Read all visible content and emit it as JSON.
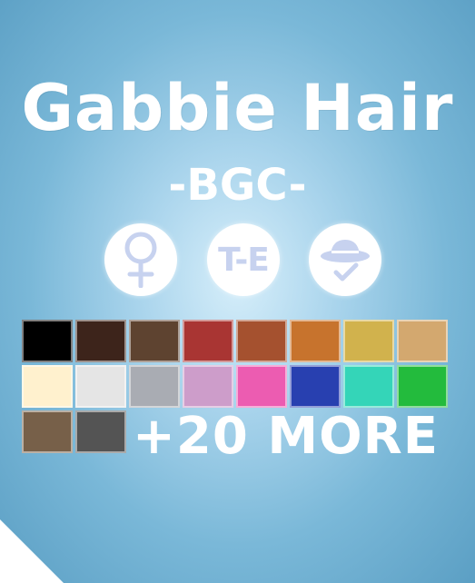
{
  "title": "Gabbie Hair",
  "subtitle": "-BGC-",
  "badges": [
    {
      "icon": "female-symbol-icon"
    },
    {
      "label": "T-E"
    },
    {
      "icon": "hat-check-icon"
    }
  ],
  "swatch_colors": [
    "#000000",
    "#3d241b",
    "#5e4330",
    "#a93533",
    "#a5512f",
    "#c7732d",
    "#d1b24d",
    "#d3a86f",
    "#fff1ce",
    "#e5e5e5",
    "#a9acb3",
    "#cd9dca",
    "#ec5cb1",
    "#2840b0",
    "#34d5b8",
    "#23bb3d",
    "#776049",
    "#545454"
  ],
  "more_label": "+20 MORE",
  "accent_colors": {
    "icon_tint": "#c7d2ef",
    "text": "#ffffff"
  }
}
